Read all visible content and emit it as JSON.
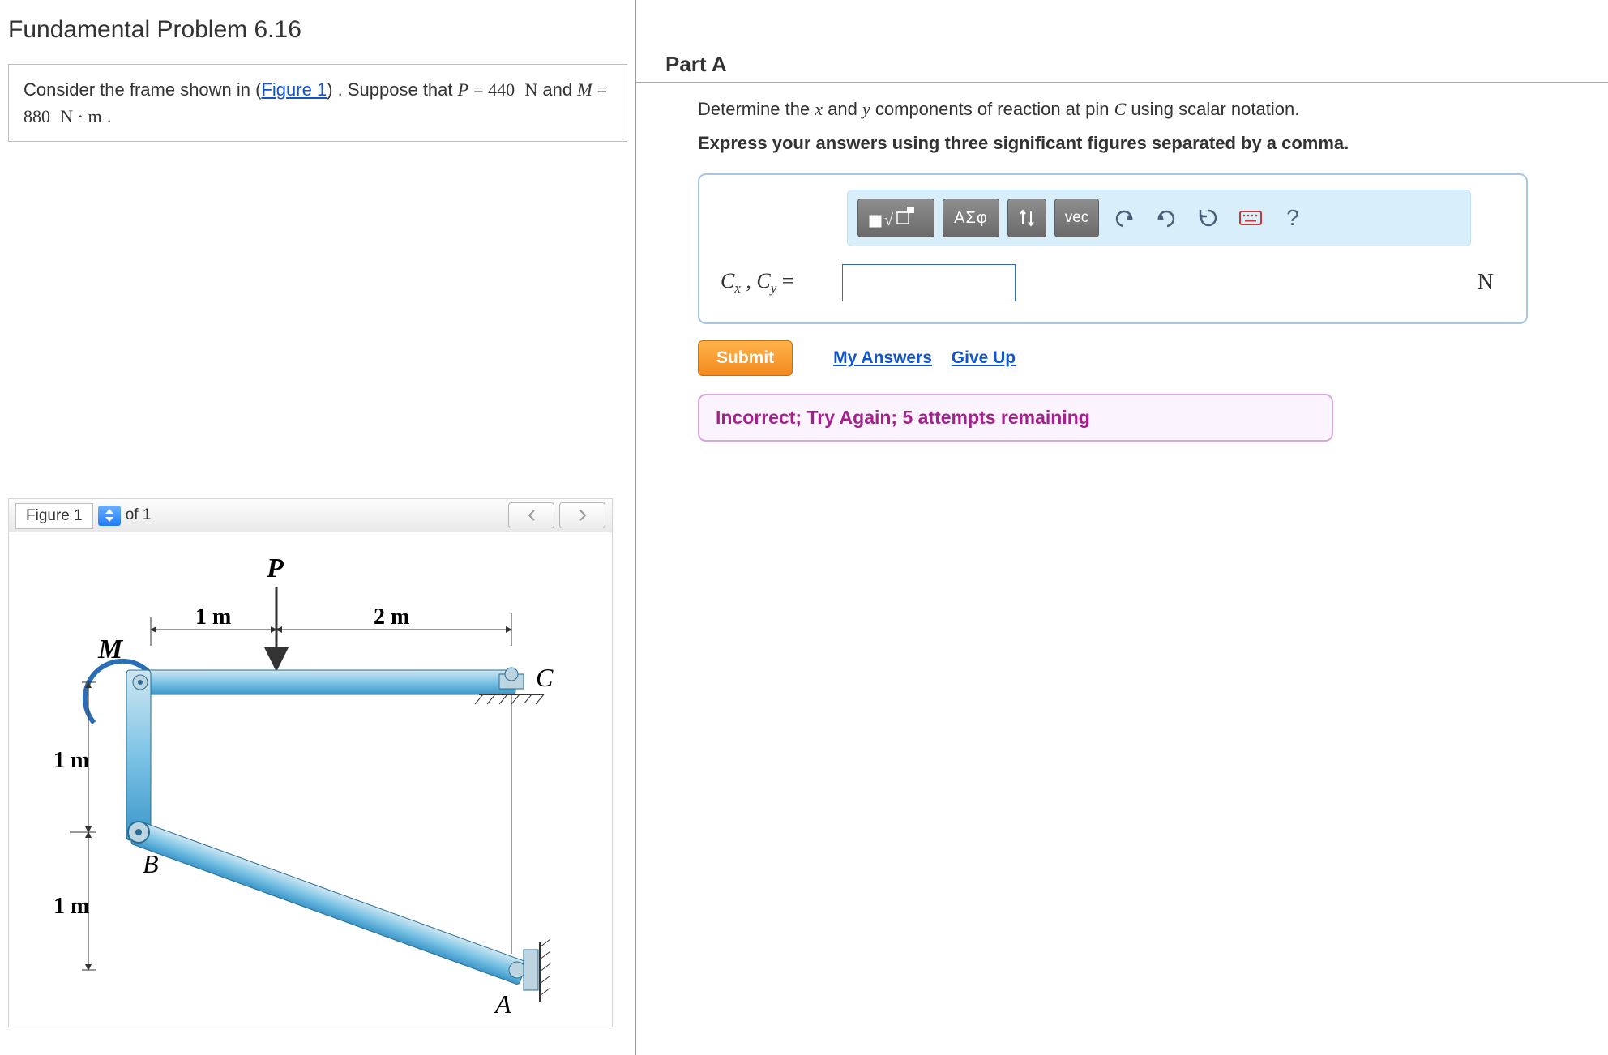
{
  "left": {
    "title": "Fundamental Problem 6.16",
    "text_prefix": "Consider the frame shown in (",
    "figure_link": "Figure 1",
    "text_mid": ") . Suppose that ",
    "eq_lhs1": "P",
    "eq_val1": "= 440",
    "unit1": "N",
    "and": " and ",
    "eq_lhs2": "M",
    "eq_val2": "= 880",
    "unit2": "N · m",
    "period": " .",
    "figure": {
      "tab": "Figure 1",
      "of": "of 1"
    }
  },
  "right": {
    "part": "Part A",
    "question_a": "Determine the ",
    "question_x": "x",
    "question_b": " and ",
    "question_y": "y",
    "question_c": " components of reaction at pin ",
    "question_C": "C",
    "question_d": " using scalar notation.",
    "instr": "Express your answers using three significant figures separated by a comma.",
    "toolbar": {
      "greek": "ΑΣφ",
      "vec": "vec"
    },
    "var_label_html": "C_x , C_y =",
    "unit": "N",
    "submit": "Submit",
    "my_answers": "My Answers",
    "give_up": "Give Up",
    "feedback": "Incorrect; Try Again; 5 attempts remaining"
  }
}
